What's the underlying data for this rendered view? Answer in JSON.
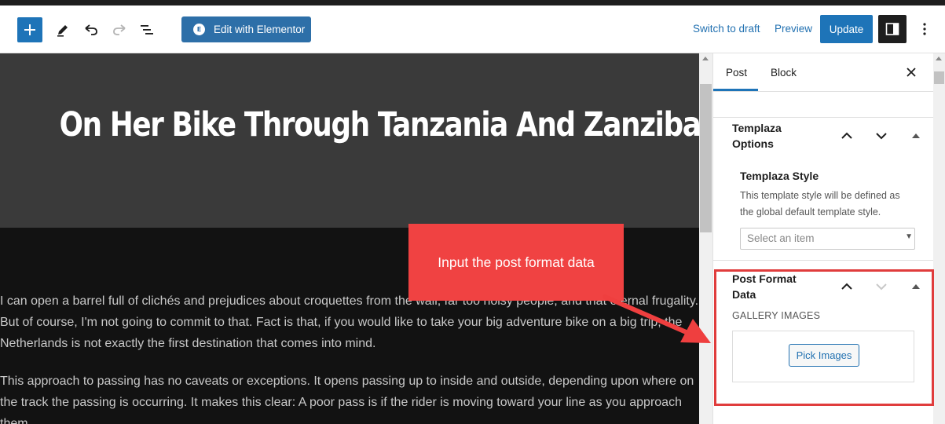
{
  "toolbar": {
    "add_icon": "plus-icon",
    "tools_icon": "pencil-icon",
    "undo_icon": "undo-icon",
    "redo_icon": "redo-icon",
    "list_view_icon": "list-view-icon",
    "elementor_label": "Edit with Elementor",
    "elementor_icon": "elementor-logo-icon",
    "switch_to_draft_label": "Switch to draft",
    "preview_label": "Preview",
    "update_label": "Update",
    "settings_icon": "sidebar-toggle-icon",
    "more_icon": "vertical-ellipsis-icon"
  },
  "editor": {
    "title": "On Her Bike Through Tanzania And Zanzibar",
    "paragraphs": [
      "I can open a barrel full of clichés and prejudices about croquettes from the wall, far too noisy people, and that eternal frugality. But of course, I'm not going to commit to that. Fact is that, if you would like to take your big adventure bike on a big trip, the Netherlands is not exactly the first destination that comes into mind.",
      "This approach to passing has no caveats or exceptions. It opens passing up to inside and outside, depending upon where on the track the passing is occurring. It makes this clear: A poor pass is if the rider is moving toward your line as you approach them."
    ]
  },
  "sidebar": {
    "tabs": [
      {
        "label": "Post",
        "active": true
      },
      {
        "label": "Block",
        "active": false
      }
    ],
    "close_icon": "close-icon",
    "sections": {
      "templaza_options": {
        "title": "Templaza Options",
        "field_label": "Templaza Style",
        "help_text": "This template style will be defined as the global default template style.",
        "select_placeholder": "Select an item"
      },
      "post_format_data": {
        "title": "Post Format Data",
        "gallery_label": "GALLERY IMAGES",
        "pick_images_label": "Pick Images"
      }
    }
  },
  "annotation": {
    "callout_text": "Input the post format data",
    "callout_color": "#f04242",
    "highlight_color": "#e03c3c"
  },
  "colors": {
    "accent": "#1e74b8",
    "link": "#2271b1",
    "canvas_bg": "#121212",
    "hero_bg": "#3a3a3a"
  }
}
